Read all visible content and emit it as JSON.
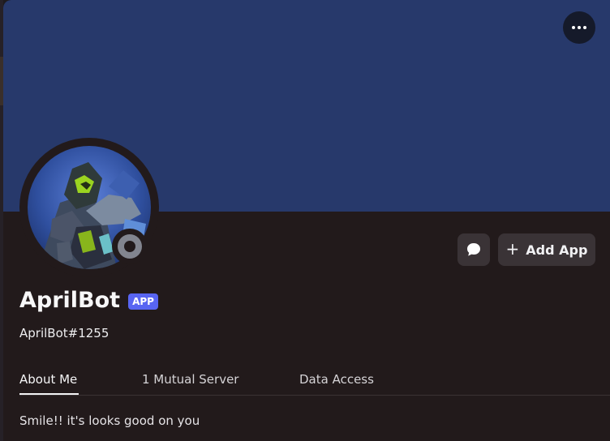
{
  "profile": {
    "display_name": "AprilBot",
    "badge": "APP",
    "username": "AprilBot#1255",
    "about_text": "Smile!! it's looks good on you",
    "status": "offline"
  },
  "actions": {
    "more_icon": "more-horizontal-icon",
    "message_icon": "chat-bubble-icon",
    "add_app_label": "Add App",
    "add_app_icon": "plus-icon"
  },
  "tabs": [
    {
      "label": "About Me",
      "active": true
    },
    {
      "label": "1 Mutual Server",
      "active": false
    },
    {
      "label": "Data Access",
      "active": false
    }
  ],
  "colors": {
    "banner": "#27396b",
    "modal_background": "#221a1b",
    "badge": "#5865f2",
    "status_offline": "#82858f",
    "button_background": "#3a3336"
  }
}
